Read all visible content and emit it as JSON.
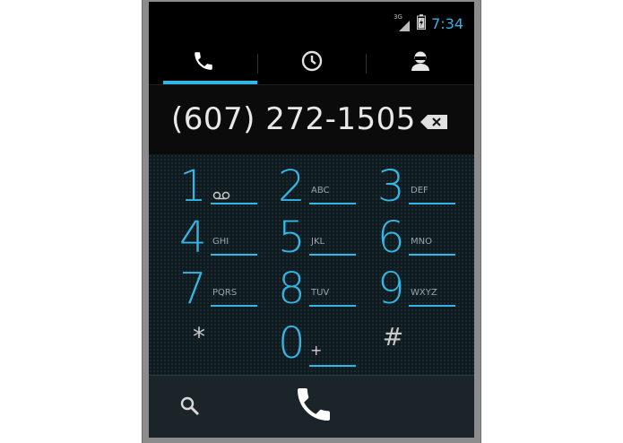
{
  "status_bar": {
    "time": "7:34",
    "network_label": "3G",
    "icons": [
      "signal-icon",
      "battery-icon"
    ]
  },
  "tabs": [
    {
      "name": "phone",
      "icon": "phone-icon",
      "active": true
    },
    {
      "name": "call-log",
      "icon": "clock-icon",
      "active": false
    },
    {
      "name": "contacts",
      "icon": "person-icon",
      "active": false
    }
  ],
  "dialer": {
    "number": "(607) 272-1505"
  },
  "keypad": [
    {
      "digit": "1",
      "letters": "",
      "icon": "voicemail-icon"
    },
    {
      "digit": "2",
      "letters": "ABC"
    },
    {
      "digit": "3",
      "letters": "DEF"
    },
    {
      "digit": "4",
      "letters": "GHI"
    },
    {
      "digit": "5",
      "letters": "JKL"
    },
    {
      "digit": "6",
      "letters": "MNO"
    },
    {
      "digit": "7",
      "letters": "PQRS"
    },
    {
      "digit": "8",
      "letters": "TUV"
    },
    {
      "digit": "9",
      "letters": "WXYZ"
    },
    {
      "digit": "*",
      "letters": ""
    },
    {
      "digit": "0",
      "letters": "+"
    },
    {
      "digit": "#",
      "letters": ""
    }
  ],
  "colors": {
    "accent": "#33b5e5",
    "background": "#000000",
    "keypad_bg": "#101b20"
  }
}
